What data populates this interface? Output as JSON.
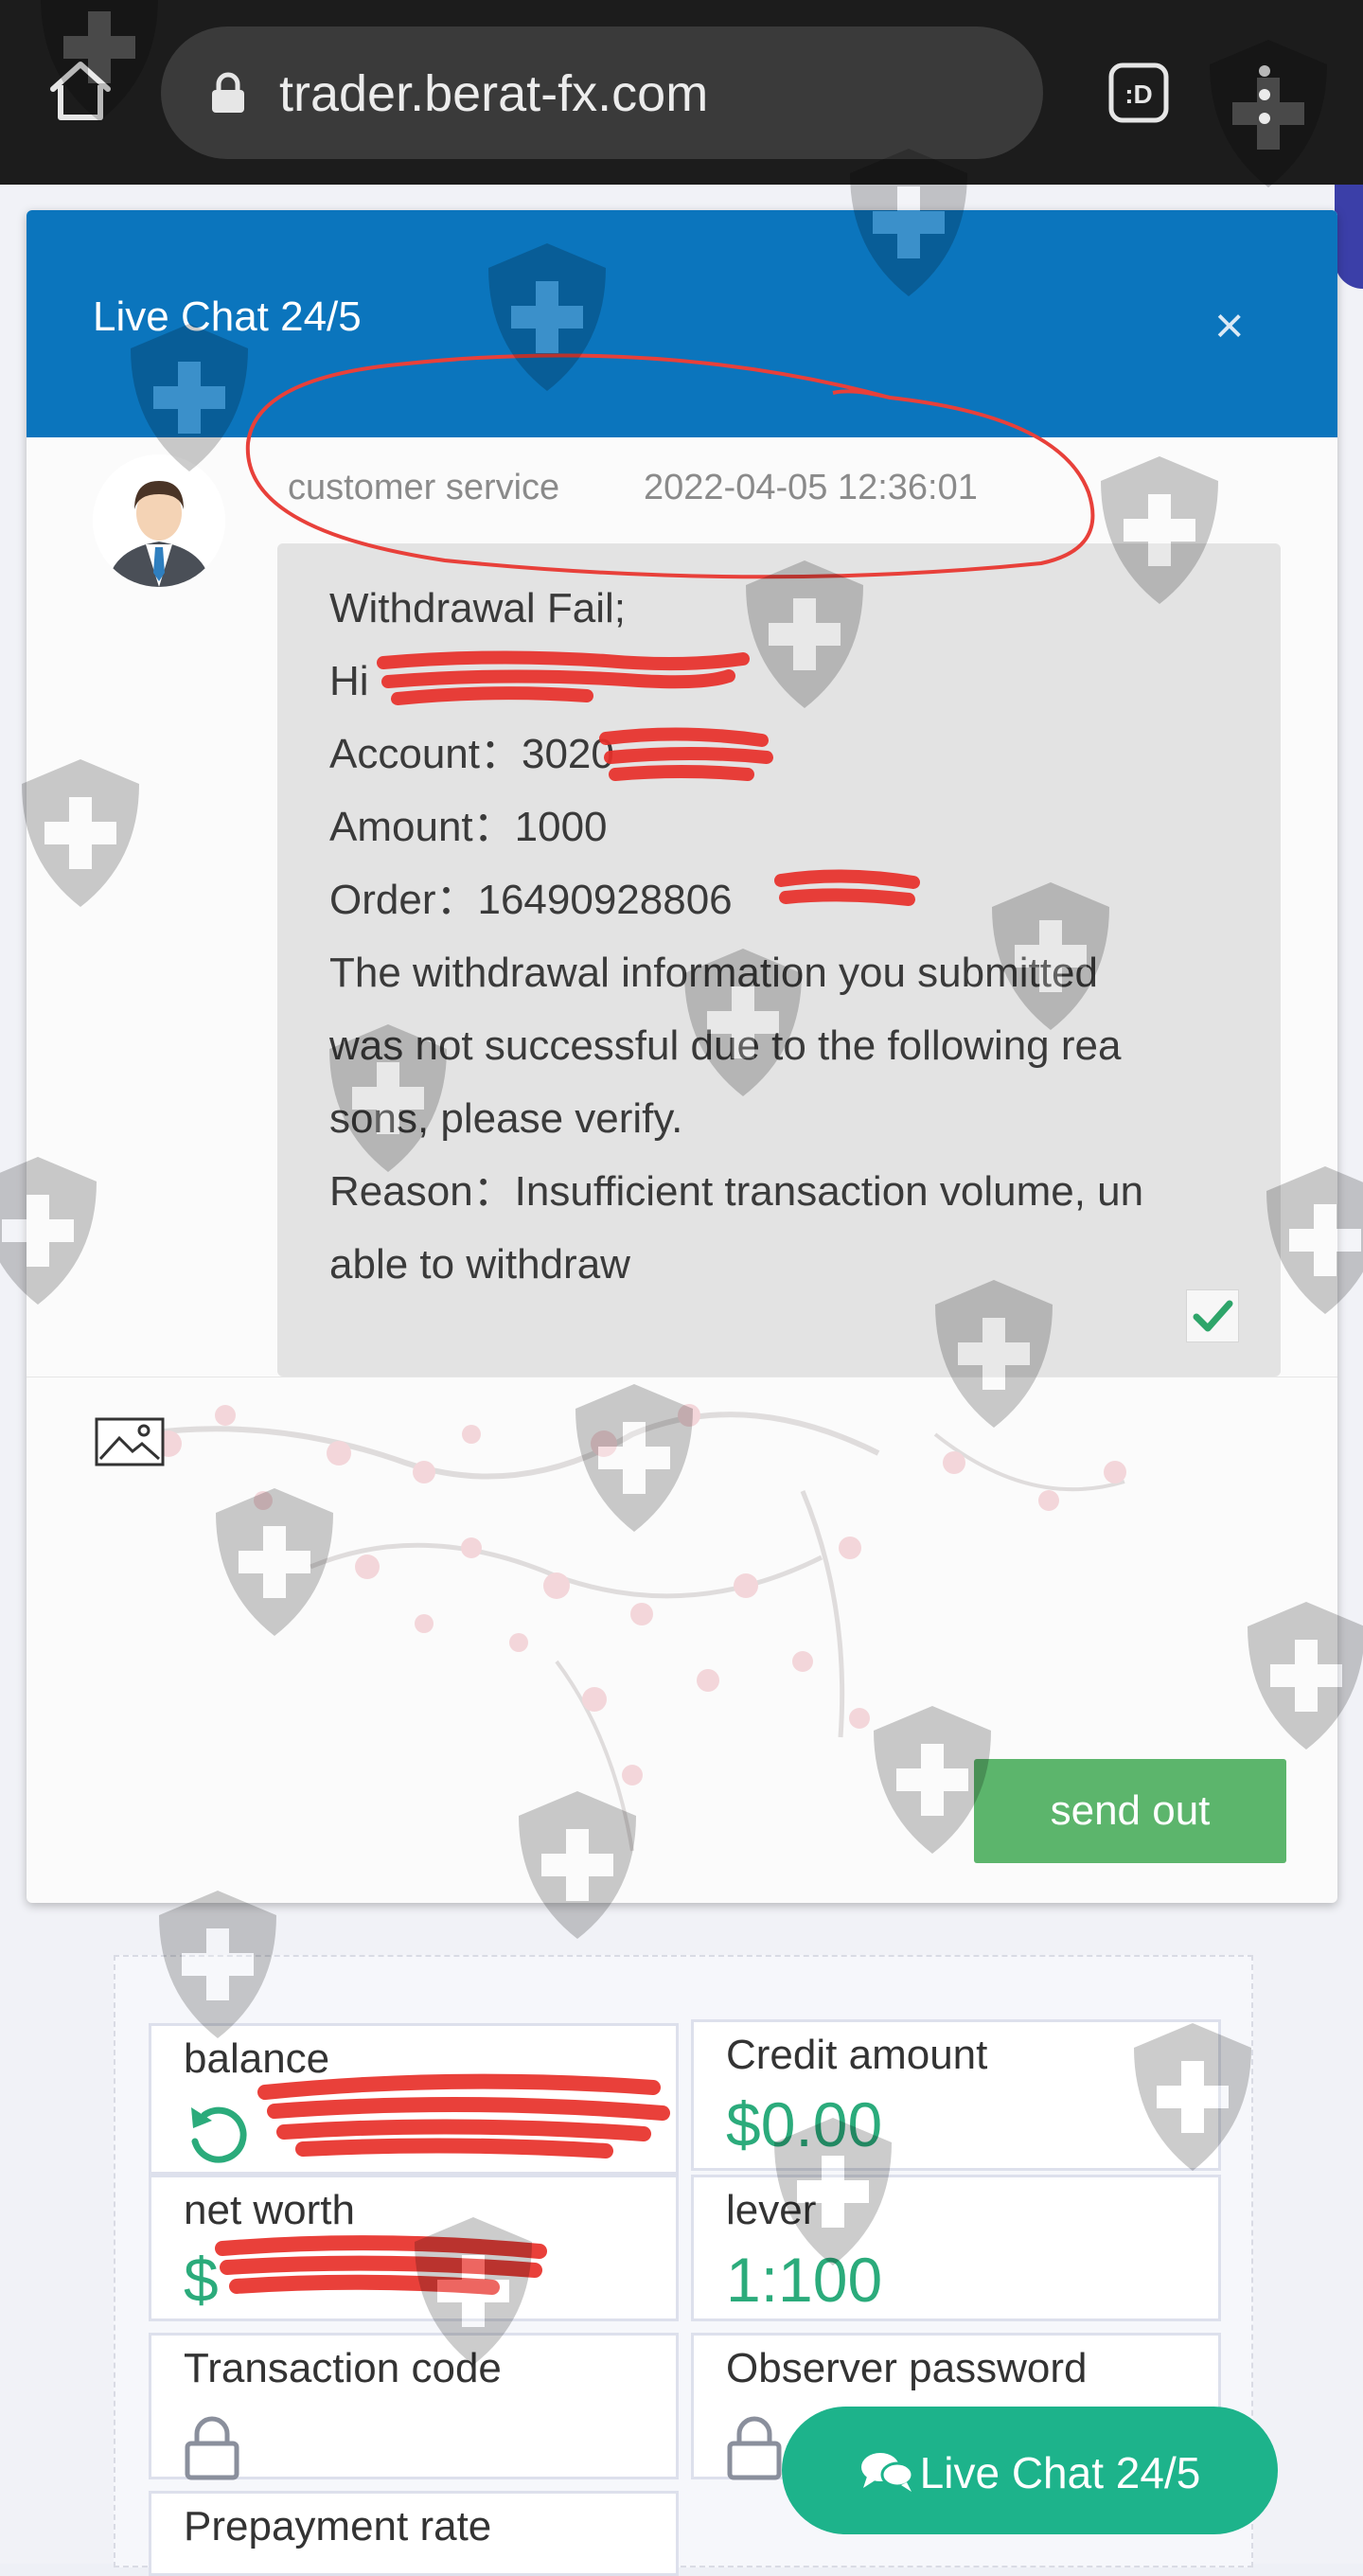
{
  "browser": {
    "url": "trader.berat-fx.com",
    "home_icon": "home-icon",
    "lock_icon": "lock-icon",
    "extension_icon": "extension-icon",
    "menu_icon": "more-vert-icon",
    "extension_label": ":D"
  },
  "chat": {
    "title": "Live Chat 24/5",
    "close_label": "×",
    "message": {
      "sender": "customer service",
      "timestamp": "2022-04-05 12:36:01",
      "lines": [
        "Withdrawal Fail;",
        "Hi",
        "Account：3020",
        "Amount：1000",
        "Order：16490928806",
        "The withdrawal information you submitted",
        "was not successful due to the following rea",
        "sons, please verify.",
        "Reason：Insufficient transaction volume, un",
        "able to withdraw"
      ]
    },
    "send_label": "send out"
  },
  "account": {
    "balance_label": "balance",
    "credit_label": "Credit amount",
    "credit_value": "$0.00",
    "net_worth_label": "net worth",
    "net_worth_value": "$",
    "lever_label": "lever",
    "lever_value": "1:100",
    "transaction_code_label": "Transaction code",
    "observer_password_label": "Observer password",
    "prepayment_label": "Prepayment rate"
  },
  "floating_button": {
    "label": "Live Chat 24/5"
  },
  "colors": {
    "header_blue": "#0b75bd",
    "send_green": "#5cb56c",
    "value_green": "#2bab7b",
    "float_green": "#1db38b",
    "redaction_red": "#e8302a"
  }
}
